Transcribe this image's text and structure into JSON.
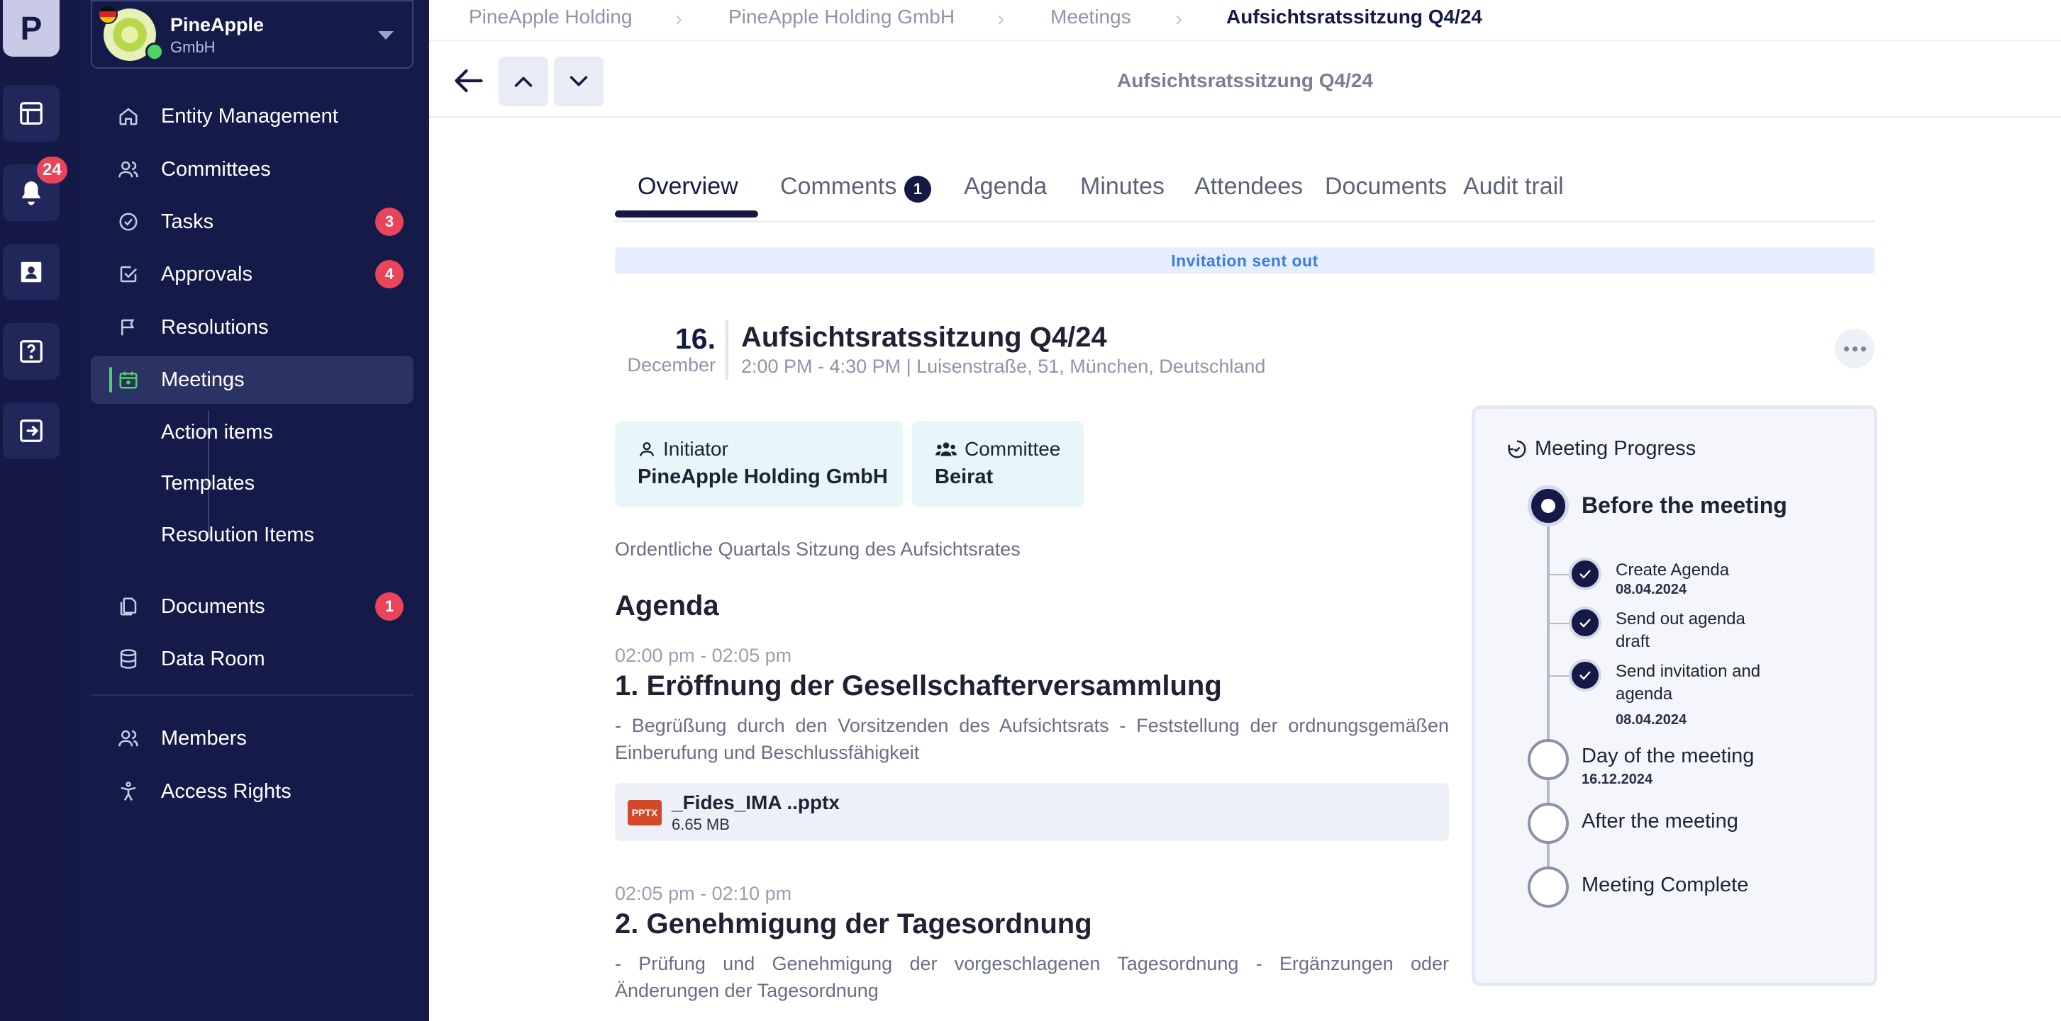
{
  "rail": {
    "logo_letter": "P",
    "notifications_count": "24"
  },
  "org": {
    "name": "PineApple",
    "subtitle": "GmbH"
  },
  "sidebar": {
    "items": [
      {
        "label": "Entity Management",
        "icon": "home-icon"
      },
      {
        "label": "Committees",
        "icon": "users-icon"
      },
      {
        "label": "Tasks",
        "icon": "check-circle-icon",
        "badge": "3"
      },
      {
        "label": "Approvals",
        "icon": "check-square-icon",
        "badge": "4"
      },
      {
        "label": "Resolutions",
        "icon": "flag-icon"
      },
      {
        "label": "Meetings",
        "icon": "calendar-icon"
      },
      {
        "label": "Action items"
      },
      {
        "label": "Templates"
      },
      {
        "label": "Resolution Items"
      },
      {
        "label": "Documents",
        "icon": "documents-icon",
        "badge": "1"
      },
      {
        "label": "Data Room",
        "icon": "database-icon"
      },
      {
        "label": "Members",
        "icon": "users-icon"
      },
      {
        "label": "Access Rights",
        "icon": "accessibility-icon"
      }
    ]
  },
  "breadcrumb": [
    "PineApple Holding",
    "PineApple Holding GmbH",
    "Meetings",
    "Aufsichtsratssitzung Q4/24"
  ],
  "topbar": {
    "title": "Aufsichtsratssitzung Q4/24"
  },
  "tabs": [
    {
      "label": "Overview"
    },
    {
      "label": "Comments",
      "count": "1"
    },
    {
      "label": "Agenda"
    },
    {
      "label": "Minutes"
    },
    {
      "label": "Attendees"
    },
    {
      "label": "Documents"
    },
    {
      "label": "Audit trail"
    }
  ],
  "status_banner": "Invitation sent out",
  "meeting": {
    "day": "16.",
    "month": "December",
    "title": "Aufsichtsratssitzung Q4/24",
    "meta": "2:00 PM - 4:30 PM | Luisenstraße, 51, München, Deutschland",
    "initiator_label": "Initiator",
    "initiator_value": "PineApple Holding GmbH",
    "committee_label": "Committee",
    "committee_value": "Beirat",
    "description": "Ordentliche Quartals Sitzung des Aufsichtsrates"
  },
  "agenda": {
    "heading": "Agenda",
    "items": [
      {
        "time": "02:00 pm - 02:05 pm",
        "title": "1. Eröffnung der Gesellschafterversammlung",
        "description": "- Begrüßung durch den Vorsitzenden des Aufsichtsrats - Feststellung der ordnungsgemäßen Einberufung und Beschlussfähigkeit",
        "attachment": {
          "type": "PPTX",
          "name": "_Fides_IMA ..pptx",
          "size": "6.65 MB"
        }
      },
      {
        "time": "02:05 pm - 02:10 pm",
        "title": "2. Genehmigung der Tagesordnung",
        "description": "- Prüfung und Genehmigung der vorgeschlagenen Tagesordnung - Ergänzungen oder Änderungen der Tagesordnung"
      }
    ]
  },
  "progress": {
    "title": "Meeting Progress",
    "steps": [
      {
        "label": "Before the meeting",
        "status": "current"
      },
      {
        "label": "Day of the meeting",
        "date": "16.12.2024"
      },
      {
        "label": "After the meeting"
      },
      {
        "label": "Meeting Complete"
      }
    ],
    "tasks": [
      {
        "label": "Create Agenda",
        "date": "08.04.2024"
      },
      {
        "label": "Send out agenda draft"
      },
      {
        "label": "Send invitation and agenda",
        "date": "08.04.2024"
      }
    ]
  },
  "colors": {
    "rail_bg": "#141a45",
    "sidebar_bg": "#151b49",
    "accent_green": "#4fd463",
    "badge_red": "#e8455b",
    "banner_blue": "#3b7be2"
  }
}
